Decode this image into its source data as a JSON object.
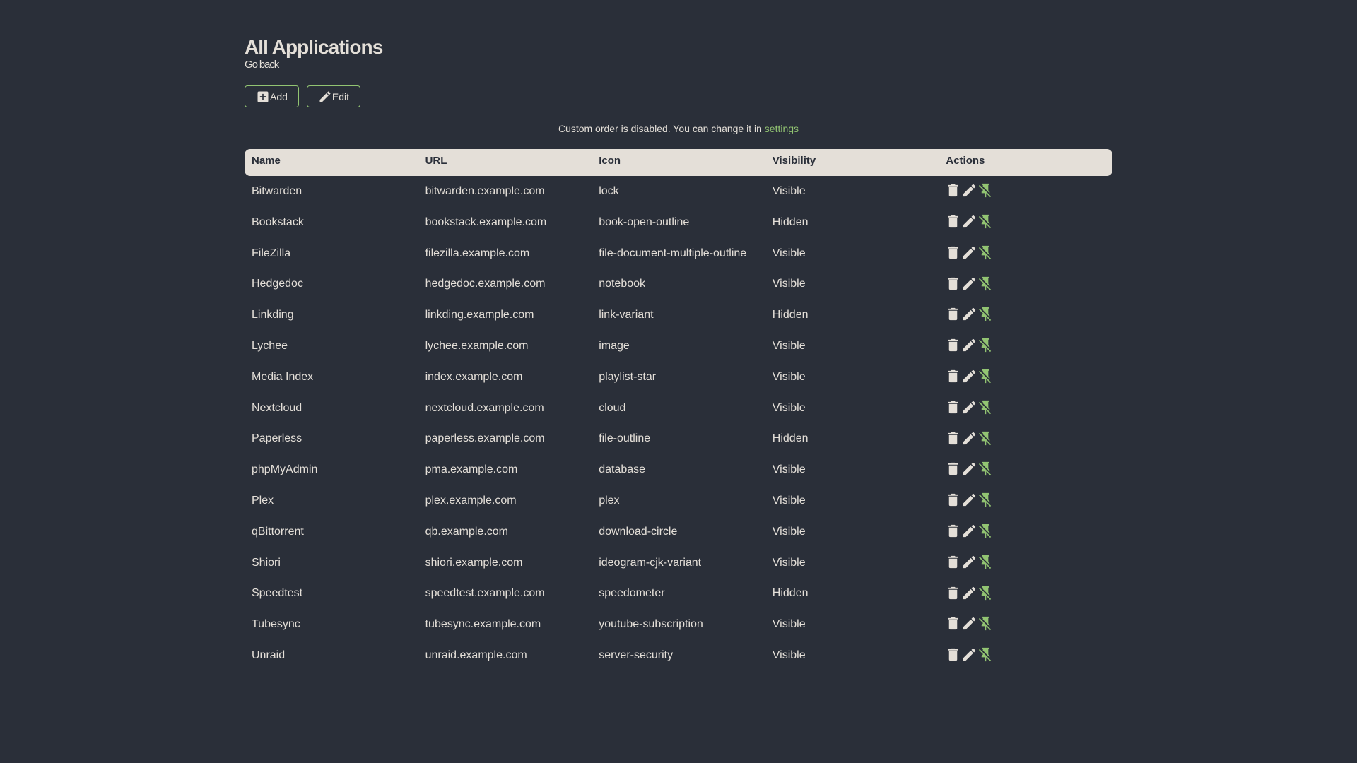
{
  "page": {
    "title": "All Applications",
    "back_link": "Go back"
  },
  "toolbar": {
    "add_label": "Add",
    "edit_label": "Edit"
  },
  "notice": {
    "text": "Custom order is disabled. You can change it in",
    "link_label": "settings"
  },
  "table": {
    "columns": [
      "Name",
      "URL",
      "Icon",
      "Visibility",
      "Actions"
    ],
    "row_action_icons": [
      "delete-icon",
      "pencil-icon",
      "pin-off-icon"
    ],
    "rows": [
      {
        "name": "Bitwarden",
        "url": "bitwarden.example.com",
        "icon": "lock",
        "visibility": "Visible"
      },
      {
        "name": "Bookstack",
        "url": "bookstack.example.com",
        "icon": "book-open-outline",
        "visibility": "Hidden"
      },
      {
        "name": "FileZilla",
        "url": "filezilla.example.com",
        "icon": "file-document-multiple-outline",
        "visibility": "Visible"
      },
      {
        "name": "Hedgedoc",
        "url": "hedgedoc.example.com",
        "icon": "notebook",
        "visibility": "Visible"
      },
      {
        "name": "Linkding",
        "url": "linkding.example.com",
        "icon": "link-variant",
        "visibility": "Hidden"
      },
      {
        "name": "Lychee",
        "url": "lychee.example.com",
        "icon": "image",
        "visibility": "Visible"
      },
      {
        "name": "Media Index",
        "url": "index.example.com",
        "icon": "playlist-star",
        "visibility": "Visible"
      },
      {
        "name": "Nextcloud",
        "url": "nextcloud.example.com",
        "icon": "cloud",
        "visibility": "Visible"
      },
      {
        "name": "Paperless",
        "url": "paperless.example.com",
        "icon": "file-outline",
        "visibility": "Hidden"
      },
      {
        "name": "phpMyAdmin",
        "url": "pma.example.com",
        "icon": "database",
        "visibility": "Visible"
      },
      {
        "name": "Plex",
        "url": "plex.example.com",
        "icon": "plex",
        "visibility": "Visible"
      },
      {
        "name": "qBittorrent",
        "url": "qb.example.com",
        "icon": "download-circle",
        "visibility": "Visible"
      },
      {
        "name": "Shiori",
        "url": "shiori.example.com",
        "icon": "ideogram-cjk-variant",
        "visibility": "Visible"
      },
      {
        "name": "Speedtest",
        "url": "speedtest.example.com",
        "icon": "speedometer",
        "visibility": "Hidden"
      },
      {
        "name": "Tubesync",
        "url": "tubesync.example.com",
        "icon": "youtube-subscription",
        "visibility": "Visible"
      },
      {
        "name": "Unraid",
        "url": "unraid.example.com",
        "icon": "server-security",
        "visibility": "Visible"
      }
    ]
  },
  "colors": {
    "background": "#2a2f39",
    "primary": "#e4dfd8",
    "accent": "#92c472"
  }
}
